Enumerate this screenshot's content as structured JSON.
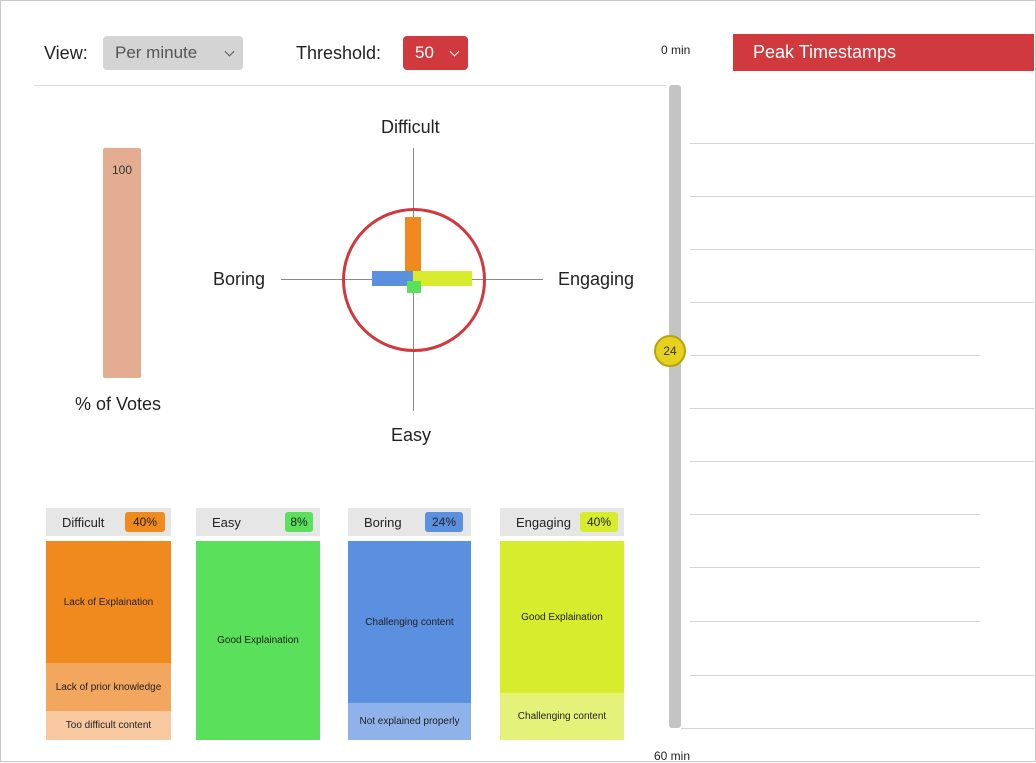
{
  "toolbar": {
    "view_label": "View:",
    "view_value": "Per minute",
    "threshold_label": "Threshold:",
    "threshold_value": "50"
  },
  "votes_meter": {
    "value": "100",
    "fill_percent": 100,
    "caption": "% of Votes"
  },
  "compass": {
    "top": "Difficult",
    "bottom": "Easy",
    "left": "Boring",
    "right": "Engaging"
  },
  "cards": [
    {
      "title": "Difficult",
      "percent": "40%",
      "segments": [
        "Lack of Explaination",
        "Lack of prior knowledge",
        "Too difficult content"
      ]
    },
    {
      "title": "Easy",
      "percent": "8%",
      "segments": [
        "Good Explaination"
      ]
    },
    {
      "title": "Boring",
      "percent": "24%",
      "segments": [
        "Challenging content",
        "Not explained properly"
      ]
    },
    {
      "title": "Engaging",
      "percent": "40%",
      "segments": [
        "Good Explaination",
        "Challenging content"
      ]
    }
  ],
  "timeline": {
    "start_label": "0 min",
    "end_label": "60 min",
    "header": "Peak Timestamps",
    "marker_value": "24"
  },
  "colors": {
    "accent_red": "#d0393d",
    "difficult": "#f08a1e",
    "easy": "#5ae05a",
    "boring": "#5b8fe0",
    "engaging": "#d6ec2c",
    "meter": "#e4ad92",
    "marker": "#e6d21c"
  }
}
